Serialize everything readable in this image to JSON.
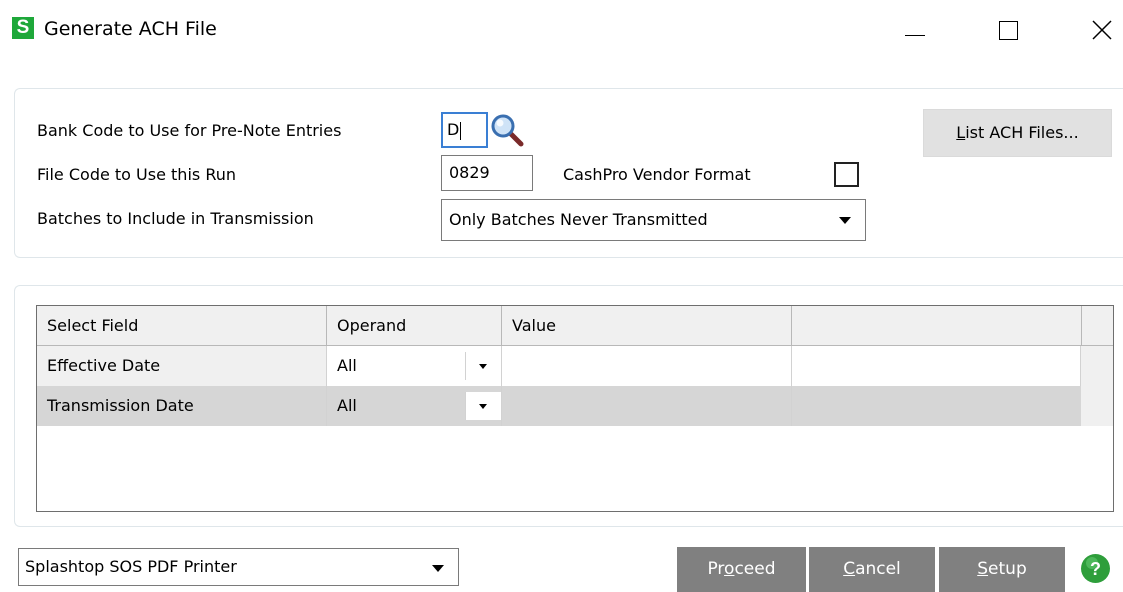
{
  "window": {
    "app_icon_letter": "S",
    "title": "Generate ACH File"
  },
  "form": {
    "bank_code_label": "Bank Code to Use for Pre-Note Entries",
    "bank_code_value": "D",
    "file_code_label": "File Code to Use this Run",
    "file_code_value": "0829",
    "cashpro_label": "CashPro Vendor Format",
    "cashpro_checked": false,
    "batches_label": "Batches to Include in Transmission",
    "batches_value": "Only Batches Never Transmitted",
    "list_button_mnemonic": "L",
    "list_button_rest": "ist ACH Files..."
  },
  "grid": {
    "headers": [
      "Select Field",
      "Operand",
      "Value",
      ""
    ],
    "rows": [
      {
        "field": "Effective Date",
        "operand": "All",
        "value": ""
      },
      {
        "field": "Transmission Date",
        "operand": "All",
        "value": ""
      }
    ]
  },
  "footer": {
    "printer": "Splashtop SOS PDF Printer",
    "proceed_pre": "Pr",
    "proceed_mnemonic": "o",
    "proceed_post": "ceed",
    "cancel_mnemonic": "C",
    "cancel_rest": "ancel",
    "setup_mnemonic": "S",
    "setup_rest": "etup",
    "help_glyph": "?"
  },
  "colors": {
    "app_icon": "#1ea83a",
    "focus_border": "#3a7fd4",
    "footer_button": "#808080",
    "help_icon": "#2e9e3b",
    "selected_row": "#d6d6d6"
  }
}
